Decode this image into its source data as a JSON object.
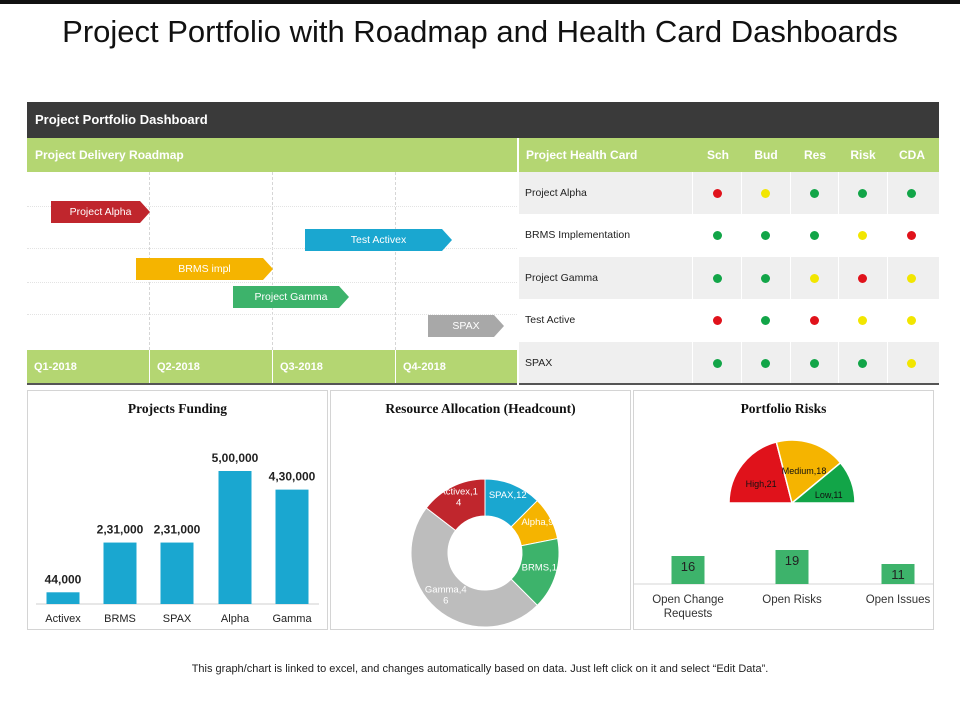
{
  "page": {
    "title": "Project Portfolio with Roadmap and Health Card Dashboards",
    "footer": "This graph/chart is linked to excel, and changes automatically based on data. Just left click on it and select “Edit Data”."
  },
  "dashboard": {
    "header": "Project Portfolio Dashboard",
    "roadmap_title": "Project Delivery Roadmap",
    "health_title": "Project Health Card",
    "health_columns": [
      "Sch",
      "Bud",
      "Res",
      "Risk",
      "CDA"
    ]
  },
  "roadmap": {
    "quarters": [
      "Q1-2018",
      "Q2-2018",
      "Q3-2018",
      "Q4-2018"
    ],
    "tasks": [
      {
        "label": "Project Alpha",
        "color": "#c0262d"
      },
      {
        "label": "Test Activex",
        "color": "#1aa7d0"
      },
      {
        "label": "BRMS  impl",
        "color": "#f5b400"
      },
      {
        "label": "Project Gamma",
        "color": "#3db36b"
      },
      {
        "label": "SPAX",
        "color": "#a8a8a8"
      }
    ]
  },
  "health_card": {
    "status_colors": {
      "red": "#e0121b",
      "yellow": "#f2e600",
      "green": "#12a548"
    },
    "rows": [
      {
        "project": "Project Alpha",
        "status": [
          "red",
          "yellow",
          "green",
          "green",
          "green"
        ]
      },
      {
        "project": "BRMS  Implementation",
        "status": [
          "green",
          "green",
          "green",
          "yellow",
          "red"
        ]
      },
      {
        "project": "Project Gamma",
        "status": [
          "green",
          "green",
          "yellow",
          "red",
          "yellow"
        ]
      },
      {
        "project": "Test Active",
        "status": [
          "red",
          "green",
          "red",
          "yellow",
          "yellow"
        ]
      },
      {
        "project": "SPAX",
        "status": [
          "green",
          "green",
          "green",
          "green",
          "yellow"
        ]
      }
    ]
  },
  "chart_data": [
    {
      "type": "bar",
      "title": "Projects Funding",
      "categories": [
        "Activex",
        "BRMS",
        "SPAX",
        "Alpha",
        "Gamma"
      ],
      "values": [
        44000,
        231000,
        231000,
        500000,
        430000
      ],
      "value_labels": [
        "44,000",
        "2,31,000",
        "2,31,000",
        "5,00,000",
        "4,30,000"
      ],
      "color": "#1aa7d0"
    },
    {
      "type": "pie",
      "title": "Resource Allocation (Headcount)",
      "donut": true,
      "slices": [
        {
          "label": "SPAX",
          "value": 12,
          "color": "#1aa7d0",
          "text": "SPAX,12"
        },
        {
          "label": "Alpha",
          "value": 9,
          "color": "#f5b400",
          "text": "Alpha,9"
        },
        {
          "label": "BRMS",
          "value": 15,
          "color": "#3db36b",
          "text": "BRMS,15"
        },
        {
          "label": "Gamma",
          "value": 46,
          "color": "#bdbdbd",
          "text": "Gamma,4 6"
        },
        {
          "label": "Activex",
          "value": 14,
          "color": "#c0262d",
          "text": "Activex,1 4"
        }
      ]
    },
    {
      "type": "pie",
      "title": "Portfolio Risks",
      "gauge": true,
      "slices": [
        {
          "label": "High",
          "value": 21,
          "color": "#e0121b",
          "text": "High,21"
        },
        {
          "label": "Medium",
          "value": 18,
          "color": "#f5b400",
          "text": "Medium,18"
        },
        {
          "label": "Low",
          "value": 11,
          "color": "#12a548",
          "text": "Low,11"
        }
      ],
      "counters": [
        {
          "label": "Open Change Requests",
          "value": 16,
          "color": "#3db36b"
        },
        {
          "label": "Open Risks",
          "value": 19,
          "color": "#3db36b"
        },
        {
          "label": "Open Issues",
          "value": 11,
          "color": "#3db36b"
        }
      ]
    }
  ]
}
